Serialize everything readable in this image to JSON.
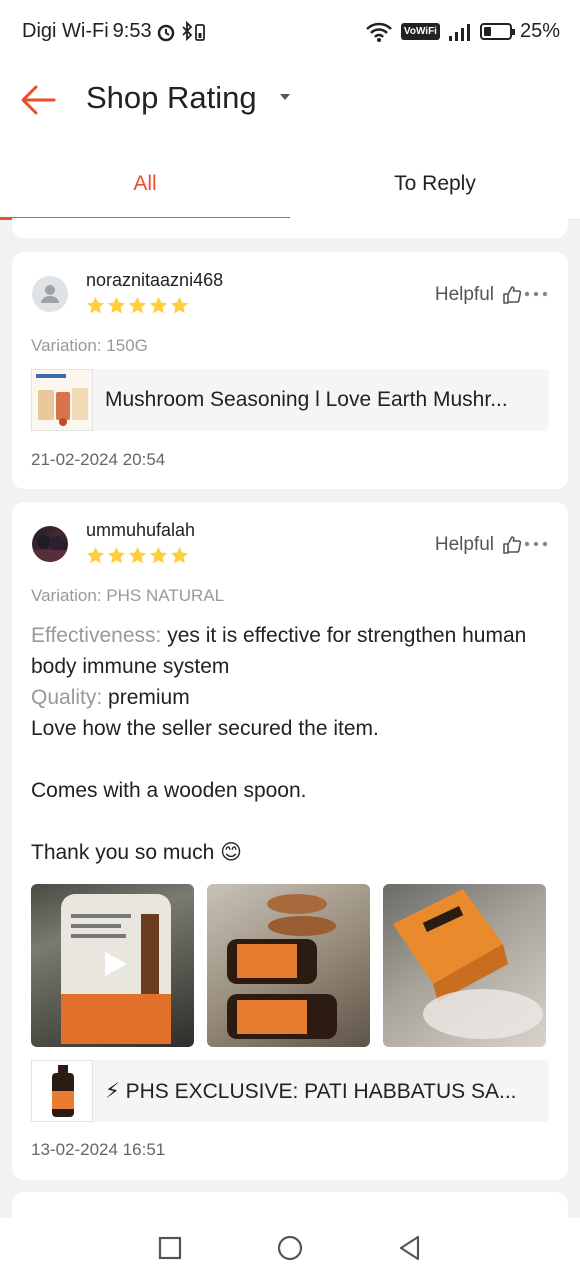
{
  "status_bar": {
    "carrier": "Digi Wi-Fi",
    "time": "9:53",
    "vowifi": "VoWiFi",
    "battery": "25%"
  },
  "header": {
    "title": "Shop Rating"
  },
  "tabs": [
    {
      "label": "All",
      "active": true
    },
    {
      "label": "To Reply",
      "active": false
    }
  ],
  "reviews": [
    {
      "username": "noraznitaazni468",
      "rating": 5,
      "helpful_label": "Helpful",
      "variation": "Variation: 150G",
      "product_name": "Mushroom Seasoning l Love Earth Mushr...",
      "date": "21-02-2024 20:54"
    },
    {
      "username": "ummuhufalah",
      "rating": 5,
      "helpful_label": "Helpful",
      "variation": "Variation: PHS NATURAL",
      "effectiveness_label": "Effectiveness:",
      "effectiveness_value": "yes it is effective for strengthen human body immune system",
      "quality_label": "Quality:",
      "quality_value": "premium",
      "comment_1": "Love how the seller secured the item.",
      "comment_2": "Comes with a wooden spoon.",
      "comment_3": "Thank you so much 😊",
      "product_name": "⚡ PHS EXCLUSIVE: PATI HABBATUS SA...",
      "date": "13-02-2024 16:51"
    }
  ],
  "colors": {
    "accent": "#ee4d2d",
    "star": "#ffce3d"
  }
}
